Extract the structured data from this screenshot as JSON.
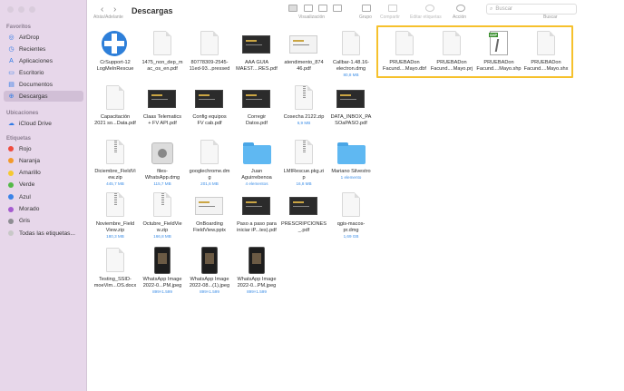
{
  "toolbar": {
    "back_label": "‹",
    "forward_label": "›",
    "nav_caption": "Atrás/Adelante",
    "title": "Descargas",
    "view_caption": "Visualización",
    "group_caption": "Grupo",
    "share_caption": "Compartir",
    "tags_caption": "Editar etiquetas",
    "action_caption": "Acción",
    "search_placeholder": "Buscar",
    "search_caption": "Buscar"
  },
  "sidebar": {
    "favorites_header": "Favoritos",
    "favorites": [
      {
        "label": "AirDrop",
        "icon": "airdrop-icon"
      },
      {
        "label": "Recientes",
        "icon": "clock-icon"
      },
      {
        "label": "Aplicaciones",
        "icon": "apps-icon"
      },
      {
        "label": "Escritorio",
        "icon": "desktop-icon"
      },
      {
        "label": "Documentos",
        "icon": "document-icon"
      },
      {
        "label": "Descargas",
        "icon": "download-icon"
      }
    ],
    "locations_header": "Ubicaciones",
    "locations": [
      {
        "label": "iCloud Drive",
        "icon": "cloud-icon"
      }
    ],
    "tags_header": "Etiquetas",
    "tags": [
      {
        "label": "Rojo",
        "color": "#ef4b3f"
      },
      {
        "label": "Naranja",
        "color": "#f39a2b"
      },
      {
        "label": "Amarillo",
        "color": "#f5c931"
      },
      {
        "label": "Verde",
        "color": "#54b948"
      },
      {
        "label": "Azul",
        "color": "#3b83e8"
      },
      {
        "label": "Morado",
        "color": "#a55bd0"
      },
      {
        "label": "Gris",
        "color": "#8e8e93"
      },
      {
        "label": "Todas las etiquetas...",
        "color": "#c8c8c8"
      }
    ]
  },
  "files": [
    {
      "name1": "CrSupport-12",
      "name2": "LogMeInRescue",
      "size": "",
      "kind": "lifebuoy"
    },
    {
      "name1": "1475_non_dep_m",
      "name2": "ac_os_en.pdf",
      "size": "",
      "kind": "pdf-text"
    },
    {
      "name1": "80778309-2545-",
      "name2": "11ed-93...pressed",
      "size": "",
      "kind": "doc"
    },
    {
      "name1": "AAA GUIA",
      "name2": "MAEST....RES.pdf",
      "size": "",
      "kind": "thumb-dark"
    },
    {
      "name1": "atendimento_874",
      "name2": "46.pdf",
      "size": "",
      "kind": "thumb-light"
    },
    {
      "name1": "Callbar-1.48.16-",
      "name2": "electron.dmg",
      "size": "80,8 MB",
      "kind": "doc"
    },
    {
      "name1": "PRUEBADon",
      "name2": "Facund....Mayo.dbf",
      "size": "",
      "kind": "doc"
    },
    {
      "name1": "PRUEBADon",
      "name2": "Facund....Mayo.prj",
      "size": "",
      "kind": "doc"
    },
    {
      "name1": "PRUEBADon",
      "name2": "Facund....Mayo.shp",
      "size": "",
      "kind": "shp"
    },
    {
      "name1": "PRUEBADon",
      "name2": "Facund....Mayo.shx",
      "size": "",
      "kind": "doc"
    },
    {
      "name1": "Capacitación",
      "name2": "2021 so...Data.pdf",
      "size": "",
      "kind": "pdf"
    },
    {
      "name1": "Claas Telematics",
      "name2": "+ FV API.pdf",
      "size": "",
      "kind": "thumb-dark"
    },
    {
      "name1": "Config equipos",
      "name2": "FV cab.pdf",
      "size": "",
      "kind": "thumb-dark"
    },
    {
      "name1": "Corregir",
      "name2": "Datos.pdf",
      "size": "",
      "kind": "thumb-dark"
    },
    {
      "name1": "Cosecha 2122.zip",
      "name2": "",
      "size": "6,9 MB",
      "kind": "zip"
    },
    {
      "name1": "DATA_INBOX_PA",
      "name2": "SOaPASO.pdf",
      "size": "",
      "kind": "thumb-dark"
    },
    {
      "name1": "Diciembre_FieldVi",
      "name2": "ew.zip",
      "size": "445,7 MB",
      "kind": "zip"
    },
    {
      "name1": "files-",
      "name2": "WhatsApp.dmg",
      "size": "115,7 MB",
      "kind": "dmg"
    },
    {
      "name1": "googlechrome.dm",
      "name2": "g",
      "size": "201,6 MB",
      "kind": "doc"
    },
    {
      "name1": "Juan",
      "name2": "Aguirrebenoa",
      "size": "4 elementos",
      "kind": "folder"
    },
    {
      "name1": "LMIRescue.pkg.zi",
      "name2": "p",
      "size": "16,8 MB",
      "kind": "zip"
    },
    {
      "name1": "Mariano Silvestro",
      "name2": "",
      "size": "1 elemento",
      "kind": "folder"
    },
    {
      "name1": "Noviembre_Field",
      "name2": "View.zip",
      "size": "180,3 MB",
      "kind": "zip"
    },
    {
      "name1": "Octubre_FieldVie",
      "name2": "w.zip",
      "size": "166,8 MB",
      "kind": "zip"
    },
    {
      "name1": "OnBoarding",
      "name2": "FieldView.pptx",
      "size": "",
      "kind": "thumb-light"
    },
    {
      "name1": "Paso a paso para",
      "name2": "iniciar iP...tes).pdf",
      "size": "",
      "kind": "thumb-dark"
    },
    {
      "name1": "PRESCRIPCIONES",
      "name2": "_.pdf",
      "size": "",
      "kind": "thumb-dark"
    },
    {
      "name1": "qgis-macos-",
      "name2": "pr.dmg",
      "size": "1,69 GB",
      "kind": "doc"
    },
    {
      "name1": "Testing_SSID-",
      "name2": "moeVim...OS.docx",
      "size": "",
      "kind": "doc"
    },
    {
      "name1": "WhatsApp Image",
      "name2": "2022-0...PM.jpeg",
      "size": "899×1.599",
      "kind": "phone"
    },
    {
      "name1": "WhatsApp Image",
      "name2": "2022-08...(1).jpeg",
      "size": "899×1.599",
      "kind": "phone"
    },
    {
      "name1": "WhatsApp Image",
      "name2": "2022-0...PM.jpeg",
      "size": "899×1.599",
      "kind": "phone"
    }
  ]
}
